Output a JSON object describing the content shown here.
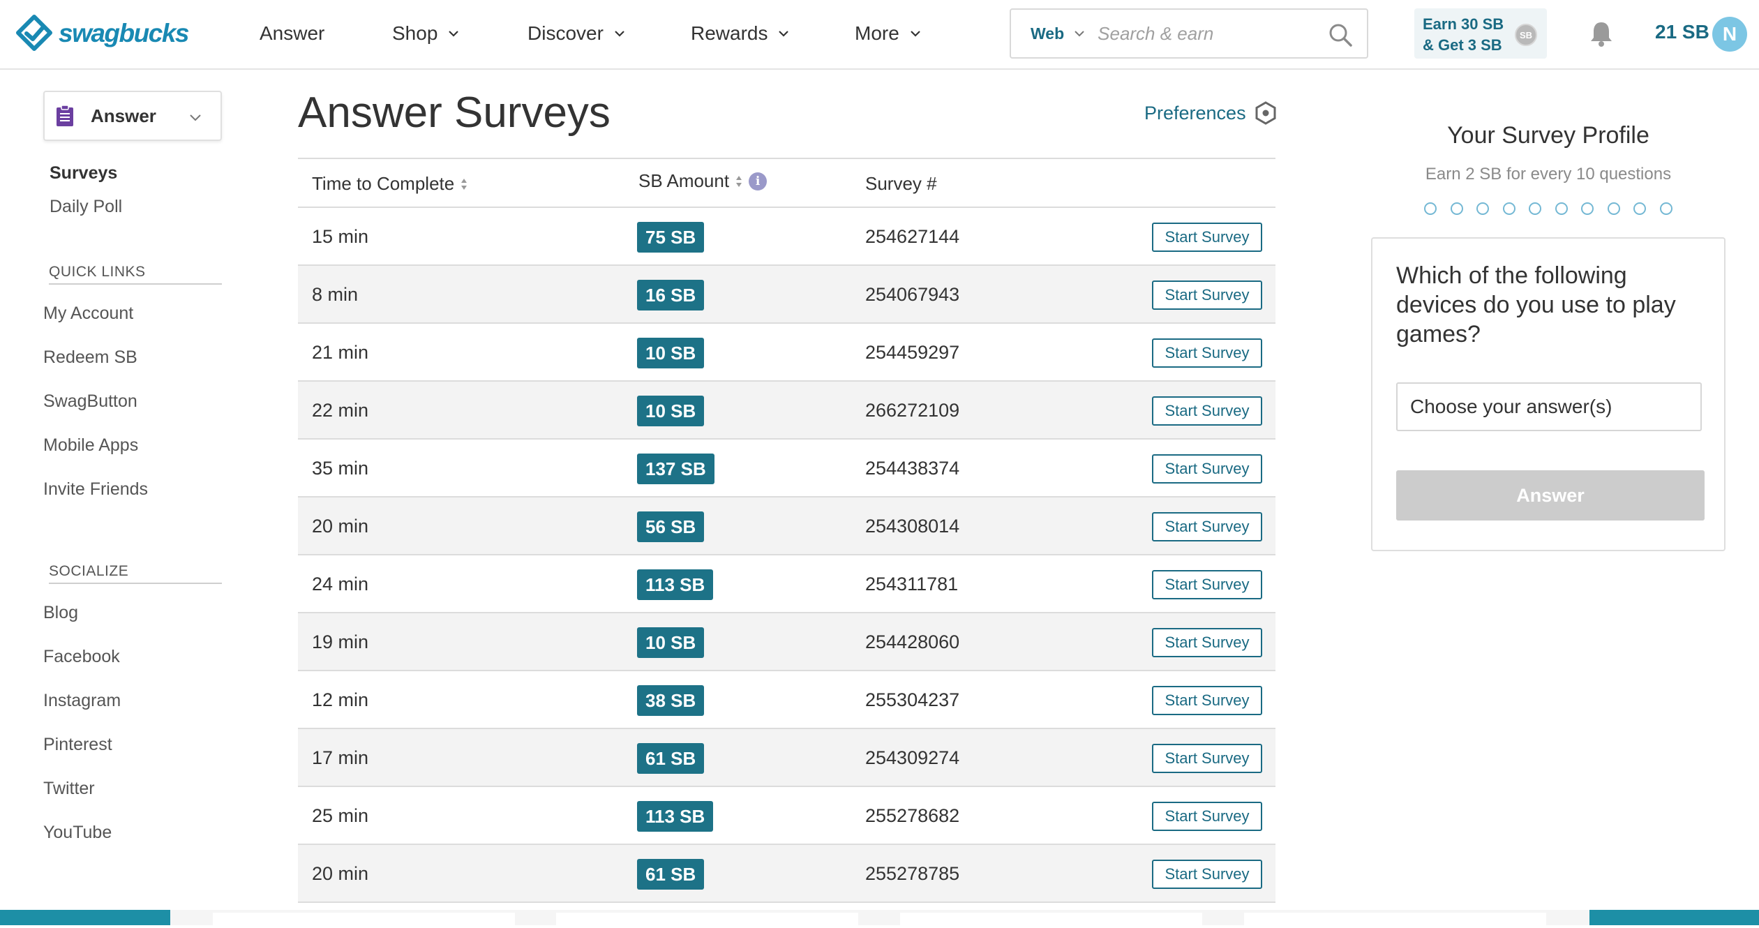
{
  "header": {
    "brand": "swagbucks",
    "nav": [
      {
        "label": "Answer",
        "has_dropdown": false
      },
      {
        "label": "Shop",
        "has_dropdown": true
      },
      {
        "label": "Discover",
        "has_dropdown": true
      },
      {
        "label": "Rewards",
        "has_dropdown": true
      },
      {
        "label": "More",
        "has_dropdown": true
      }
    ],
    "search": {
      "type": "Web",
      "placeholder": "Search & earn"
    },
    "promo": {
      "line1": "Earn 30 SB",
      "line2": "& Get 3 SB",
      "coin": "SB"
    },
    "balance": "21 SB",
    "avatar_initial": "N"
  },
  "sidebar": {
    "selector_label": "Answer",
    "sub_items": [
      {
        "label": "Surveys",
        "active": true
      },
      {
        "label": "Daily Poll",
        "active": false
      }
    ],
    "quick_links_heading": "QUICK LINKS",
    "quick_links": [
      "My Account",
      "Redeem SB",
      "SwagButton",
      "Mobile Apps",
      "Invite Friends"
    ],
    "socialize_heading": "SOCIALIZE",
    "social_links": [
      "Blog",
      "Facebook",
      "Instagram",
      "Pinterest",
      "Twitter",
      "YouTube"
    ]
  },
  "main": {
    "title": "Answer Surveys",
    "preferences_label": "Preferences",
    "columns": {
      "time": "Time to Complete",
      "amount": "SB Amount",
      "survey": "Survey #"
    },
    "info_glyph": "i",
    "start_label": "Start Survey",
    "rows": [
      {
        "time": "15 min",
        "amount": "75 SB",
        "survey": "254627144"
      },
      {
        "time": "8 min",
        "amount": "16 SB",
        "survey": "254067943"
      },
      {
        "time": "21 min",
        "amount": "10 SB",
        "survey": "254459297"
      },
      {
        "time": "22 min",
        "amount": "10 SB",
        "survey": "266272109"
      },
      {
        "time": "35 min",
        "amount": "137 SB",
        "survey": "254438374"
      },
      {
        "time": "20 min",
        "amount": "56 SB",
        "survey": "254308014"
      },
      {
        "time": "24 min",
        "amount": "113 SB",
        "survey": "254311781"
      },
      {
        "time": "19 min",
        "amount": "10 SB",
        "survey": "254428060"
      },
      {
        "time": "12 min",
        "amount": "38 SB",
        "survey": "255304237"
      },
      {
        "time": "17 min",
        "amount": "61 SB",
        "survey": "254309274"
      },
      {
        "time": "25 min",
        "amount": "113 SB",
        "survey": "255278682"
      },
      {
        "time": "20 min",
        "amount": "61 SB",
        "survey": "255278785"
      }
    ]
  },
  "profile": {
    "title": "Your Survey Profile",
    "subtitle": "Earn 2 SB for every 10 questions",
    "progress_total": 10,
    "progress_done": 0,
    "question": "Which of the following devices do you use to play games?",
    "answer_placeholder": "Choose your answer(s)",
    "answer_button": "Answer"
  },
  "colors": {
    "brand": "#1989b3",
    "accent": "#1a6a83",
    "badge": "#1d7287",
    "disabled_button": "#cccccc"
  }
}
